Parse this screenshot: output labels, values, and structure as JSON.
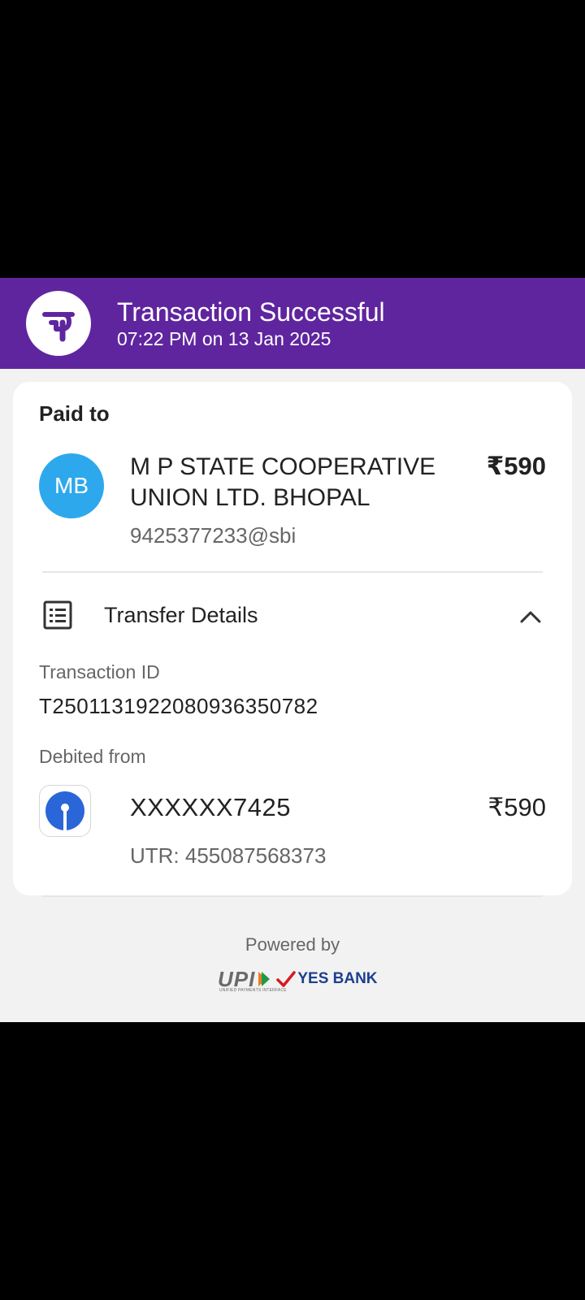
{
  "header": {
    "title": "Transaction Successful",
    "datetime": "07:22 PM on 13 Jan 2025",
    "logo_icon": "phonepe-logo-icon",
    "bg_color": "#5f259f"
  },
  "paid_to": {
    "label": "Paid to",
    "avatar_initials": "MB",
    "avatar_color": "#2ea8ec",
    "name": "M P STATE COOPERATIVE UNION LTD. BHOPAL",
    "amount": "₹590",
    "upi_id": "9425377233@sbi"
  },
  "transfer_details": {
    "label": "Transfer Details",
    "icon": "receipt-list-icon",
    "toggle_icon": "chevron-up-icon",
    "transaction_id_label": "Transaction ID",
    "transaction_id": "T2501131922080936350782",
    "debited_from_label": "Debited from",
    "account": "XXXXXX7425",
    "account_amount": "₹590",
    "bank_icon": "sbi-bank-icon",
    "utr": "UTR: 455087568373"
  },
  "footer": {
    "powered_by": "Powered by",
    "upi_logo_text": "UPI",
    "upi_logo_subtext": "UNIFIED PAYMENTS INTERFACE",
    "bank_name": "YES BANK"
  }
}
